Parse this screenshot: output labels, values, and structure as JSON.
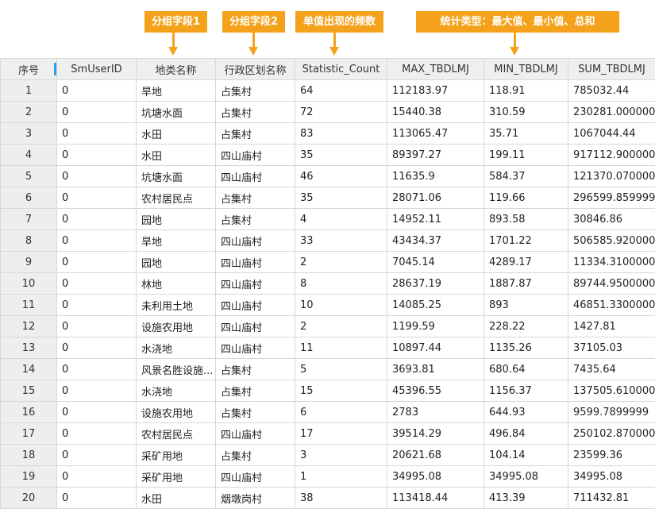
{
  "annotations": [
    {
      "label": "分组字段1"
    },
    {
      "label": "分组字段2"
    },
    {
      "label": "单值出现的频数"
    },
    {
      "label": "统计类型：最大值、最小值、总和"
    }
  ],
  "table": {
    "columns": [
      "序号",
      "SmUserID",
      "地类名称",
      "行政区划名称",
      "Statistic_Count",
      "MAX_TBDLMJ",
      "MIN_TBDLMJ",
      "SUM_TBDLMJ"
    ],
    "rows": [
      [
        "1",
        "0",
        "旱地",
        "占集村",
        "64",
        "112183.97",
        "118.91",
        "785032.44"
      ],
      [
        "2",
        "0",
        "坑塘水面",
        "占集村",
        "72",
        "15440.38",
        "310.59",
        "230281.000000"
      ],
      [
        "3",
        "0",
        "水田",
        "占集村",
        "83",
        "113065.47",
        "35.71",
        "1067044.44"
      ],
      [
        "4",
        "0",
        "水田",
        "四山庙村",
        "35",
        "89397.27",
        "199.11",
        "917112.900000"
      ],
      [
        "5",
        "0",
        "坑塘水面",
        "四山庙村",
        "46",
        "11635.9",
        "584.37",
        "121370.070000"
      ],
      [
        "6",
        "0",
        "农村居民点",
        "占集村",
        "35",
        "28071.06",
        "119.66",
        "296599.859999"
      ],
      [
        "7",
        "0",
        "园地",
        "占集村",
        "4",
        "14952.11",
        "893.58",
        "30846.86"
      ],
      [
        "8",
        "0",
        "旱地",
        "四山庙村",
        "33",
        "43434.37",
        "1701.22",
        "506585.920000"
      ],
      [
        "9",
        "0",
        "园地",
        "四山庙村",
        "2",
        "7045.14",
        "4289.17",
        "11334.3100000"
      ],
      [
        "10",
        "0",
        "林地",
        "四山庙村",
        "8",
        "28637.19",
        "1887.87",
        "89744.9500000"
      ],
      [
        "11",
        "0",
        "未利用土地",
        "四山庙村",
        "10",
        "14085.25",
        "893",
        "46851.3300000"
      ],
      [
        "12",
        "0",
        "设施农用地",
        "四山庙村",
        "2",
        "1199.59",
        "228.22",
        "1427.81"
      ],
      [
        "13",
        "0",
        "水浇地",
        "四山庙村",
        "11",
        "10897.44",
        "1135.26",
        "37105.03"
      ],
      [
        "14",
        "0",
        "风景名胜设施...",
        "占集村",
        "5",
        "3693.81",
        "680.64",
        "7435.64"
      ],
      [
        "15",
        "0",
        "水浇地",
        "占集村",
        "15",
        "45396.55",
        "1156.37",
        "137505.610000"
      ],
      [
        "16",
        "0",
        "设施农用地",
        "占集村",
        "6",
        "2783",
        "644.93",
        "9599.7899999"
      ],
      [
        "17",
        "0",
        "农村居民点",
        "四山庙村",
        "17",
        "39514.29",
        "496.84",
        "250102.870000"
      ],
      [
        "18",
        "0",
        "采矿用地",
        "占集村",
        "3",
        "20621.68",
        "104.14",
        "23599.36"
      ],
      [
        "19",
        "0",
        "采矿用地",
        "四山庙村",
        "1",
        "34995.08",
        "34995.08",
        "34995.08"
      ],
      [
        "20",
        "0",
        "水田",
        "烟墩岗村",
        "38",
        "113418.44",
        "413.39",
        "711432.81"
      ]
    ]
  },
  "colors": {
    "callout": "#f4a21c",
    "selection_marker": "#2f9fe0",
    "header_bg": "#efefef"
  }
}
